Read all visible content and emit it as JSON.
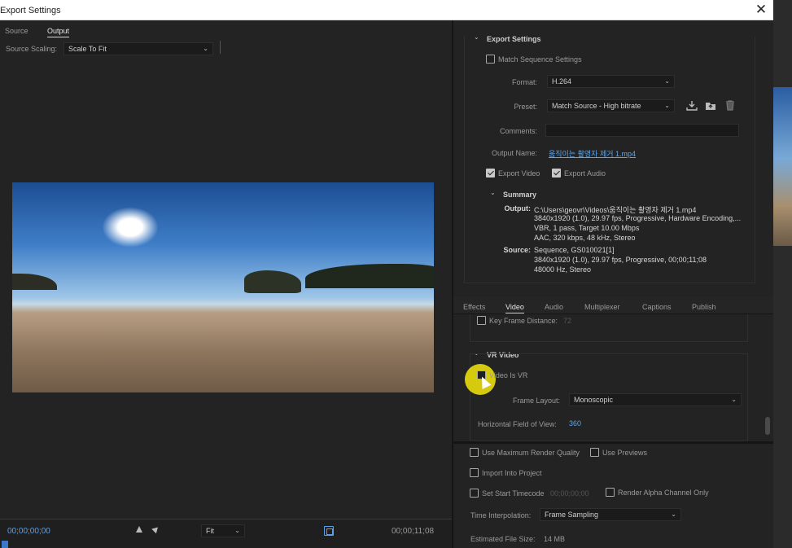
{
  "window": {
    "title": "Export Settings",
    "close": "✕"
  },
  "left": {
    "tabs": [
      "Source",
      "Output"
    ],
    "source_scaling_label": "Source Scaling:",
    "source_scaling_value": "Scale To Fit",
    "timecode_start": "00;00;00;00",
    "timecode_end": "00;00;11;08",
    "fit_value": "Fit"
  },
  "export_settings": {
    "section_title": "Export Settings",
    "match_sequence": {
      "label": "Match Sequence Settings",
      "checked": false
    },
    "format_label": "Format:",
    "format_value": "H.264",
    "preset_label": "Preset:",
    "preset_value": "Match Source - High bitrate",
    "comments_label": "Comments:",
    "comments_value": "",
    "output_name_label": "Output Name:",
    "output_name_value": "움직이는 촬영자 제거 1.mp4",
    "export_video": {
      "label": "Export Video",
      "checked": true
    },
    "export_audio": {
      "label": "Export Audio",
      "checked": true
    }
  },
  "summary": {
    "title": "Summary",
    "output_label": "Output:",
    "output_lines": [
      "C:\\Users\\geovr\\Videos\\움직이는 촬영자 제거 1.mp4",
      "3840x1920 (1.0), 29.97 fps, Progressive, Hardware Encoding,...",
      "VBR, 1 pass, Target 10.00 Mbps",
      "AAC, 320 kbps, 48 kHz, Stereo"
    ],
    "source_label": "Source:",
    "source_lines": [
      "Sequence, GS010021[1]",
      "3840x1920 (1.0), 29.97 fps, Progressive, 00;00;11;08",
      "48000 Hz, Stereo"
    ]
  },
  "tabs": [
    "Effects",
    "Video",
    "Audio",
    "Multiplexer",
    "Captions",
    "Publish"
  ],
  "video": {
    "key_frame_label": "Key Frame Distance:",
    "key_frame_value": "72",
    "vr_title": "VR Video",
    "video_is_vr": {
      "label": "Video Is VR",
      "checked": false
    },
    "frame_layout_label": "Frame Layout:",
    "frame_layout_value": "Monoscopic",
    "hfov_label": "Horizontal Field of View:",
    "hfov_value": "360"
  },
  "bottom": {
    "max_render_quality": "Use Maximum Render Quality",
    "use_previews": "Use Previews",
    "import_into_project": "Import Into Project",
    "set_start_timecode": "Set Start Timecode",
    "start_timecode_value": "00;00;00;00",
    "render_alpha": "Render Alpha Channel Only",
    "time_interp_label": "Time Interpolation:",
    "time_interp_value": "Frame Sampling",
    "file_size_label": "Estimated File Size:",
    "file_size_value": "14 MB"
  },
  "colors": {
    "accent": "#5aa7ee",
    "cursor_highlight": "#e9dd0c"
  }
}
